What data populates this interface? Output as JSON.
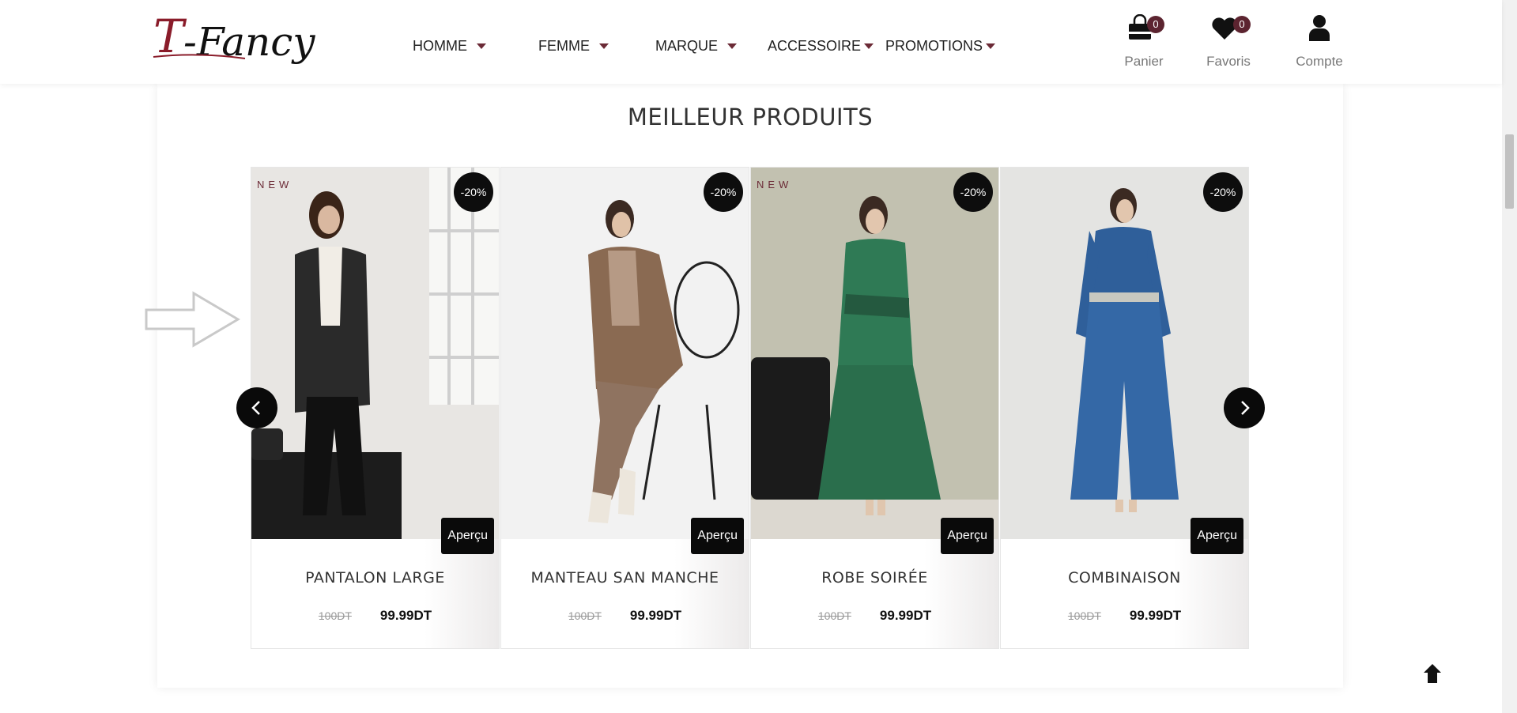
{
  "header": {
    "logo_text": "T-Fancy",
    "nav": [
      {
        "label": "HOMME"
      },
      {
        "label": "FEMME"
      },
      {
        "label": "MARQUE"
      },
      {
        "label": "ACCESSOIRE"
      },
      {
        "label": "PROMOTIONS"
      }
    ],
    "icons": {
      "cart": {
        "label": "Panier",
        "count": "0",
        "icon": "shopping-bag-icon"
      },
      "favorites": {
        "label": "Favoris",
        "count": "0",
        "icon": "heart-icon"
      },
      "account": {
        "label": "Compte",
        "icon": "user-icon"
      }
    },
    "accent_color": "#5c2430"
  },
  "section": {
    "title": "MEILLEUR PRODUITS"
  },
  "products": [
    {
      "name": "PANTALON LARGE",
      "old_price": "100DT",
      "price": "99.99DT",
      "discount": "-20%",
      "tag": "NEW",
      "preview": "Aperçu"
    },
    {
      "name": "MANTEAU SAN MANCHE",
      "old_price": "100DT",
      "price": "99.99DT",
      "discount": "-20%",
      "tag": "",
      "preview": "Aperçu"
    },
    {
      "name": "ROBE SOIRÉE",
      "old_price": "100DT",
      "price": "99.99DT",
      "discount": "-20%",
      "tag": "NEW",
      "preview": "Aperçu"
    },
    {
      "name": "COMBINAISON",
      "old_price": "100DT",
      "price": "99.99DT",
      "discount": "-20%",
      "tag": "",
      "preview": "Aperçu"
    }
  ]
}
